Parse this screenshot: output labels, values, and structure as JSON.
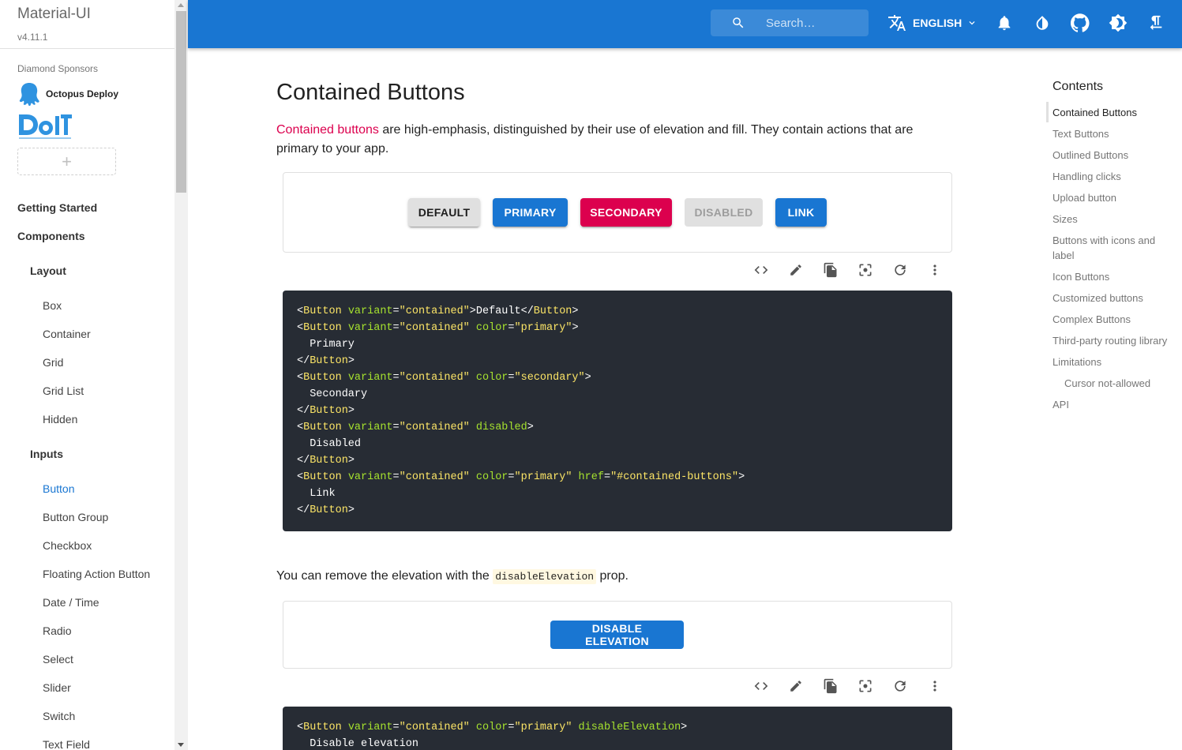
{
  "sidebar": {
    "title": "Material-UI",
    "version": "v4.11.1",
    "sponsors_label": "Diamond Sponsors",
    "sponsor1": "Octopus Deploy",
    "add_symbol": "+",
    "top": [
      "Getting Started",
      "Components"
    ],
    "layout_label": "Layout",
    "layout_items": [
      "Box",
      "Container",
      "Grid",
      "Grid List",
      "Hidden"
    ],
    "inputs_label": "Inputs",
    "inputs_items": [
      "Button",
      "Button Group",
      "Checkbox",
      "Floating Action Button",
      "Date / Time",
      "Radio",
      "Select",
      "Slider",
      "Switch",
      "Text Field"
    ]
  },
  "appbar": {
    "search_placeholder": "Search…",
    "language": "ENGLISH",
    "color": "#1976d2"
  },
  "main": {
    "title": "Contained Buttons",
    "intro_link": "Contained buttons",
    "intro_rest": " are high-emphasis, distinguished by their use of elevation and fill. They contain actions that are primary to your app.",
    "buttons": [
      "DEFAULT",
      "PRIMARY",
      "SECONDARY",
      "DISABLED",
      "LINK"
    ],
    "p2_before": "You can remove the elevation with the ",
    "p2_code": "disableElevation",
    "p2_after": " prop.",
    "button2": "DISABLE ELEVATION"
  },
  "toc": {
    "title": "Contents",
    "items": [
      "Contained Buttons",
      "Text Buttons",
      "Outlined Buttons",
      "Handling clicks",
      "Upload button",
      "Sizes",
      "Buttons with icons and label",
      "Icon Buttons",
      "Customized buttons",
      "Complex Buttons",
      "Third-party routing library",
      "Limitations",
      "Cursor not-allowed",
      "API"
    ]
  }
}
